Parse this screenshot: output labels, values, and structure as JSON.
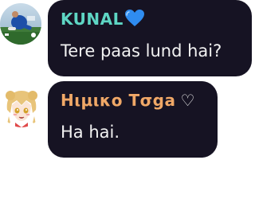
{
  "messages": [
    {
      "sender": "KUNAL",
      "sender_color": "#5ed6c4",
      "sender_badge_icon": "blue-heart-icon",
      "text": "Tere paas lund hai?",
      "avatar_icon": "soccer-player-avatar"
    },
    {
      "sender": "Ηιμικο Τσga",
      "sender_color": "#f0a867",
      "sender_badge": "♡",
      "text": "Ha hai.",
      "avatar_icon": "anime-girl-avatar"
    }
  ],
  "colors": {
    "bubble_bg": "#161323",
    "message_text": "#f2f2f2",
    "page_bg": "#ffffff"
  }
}
